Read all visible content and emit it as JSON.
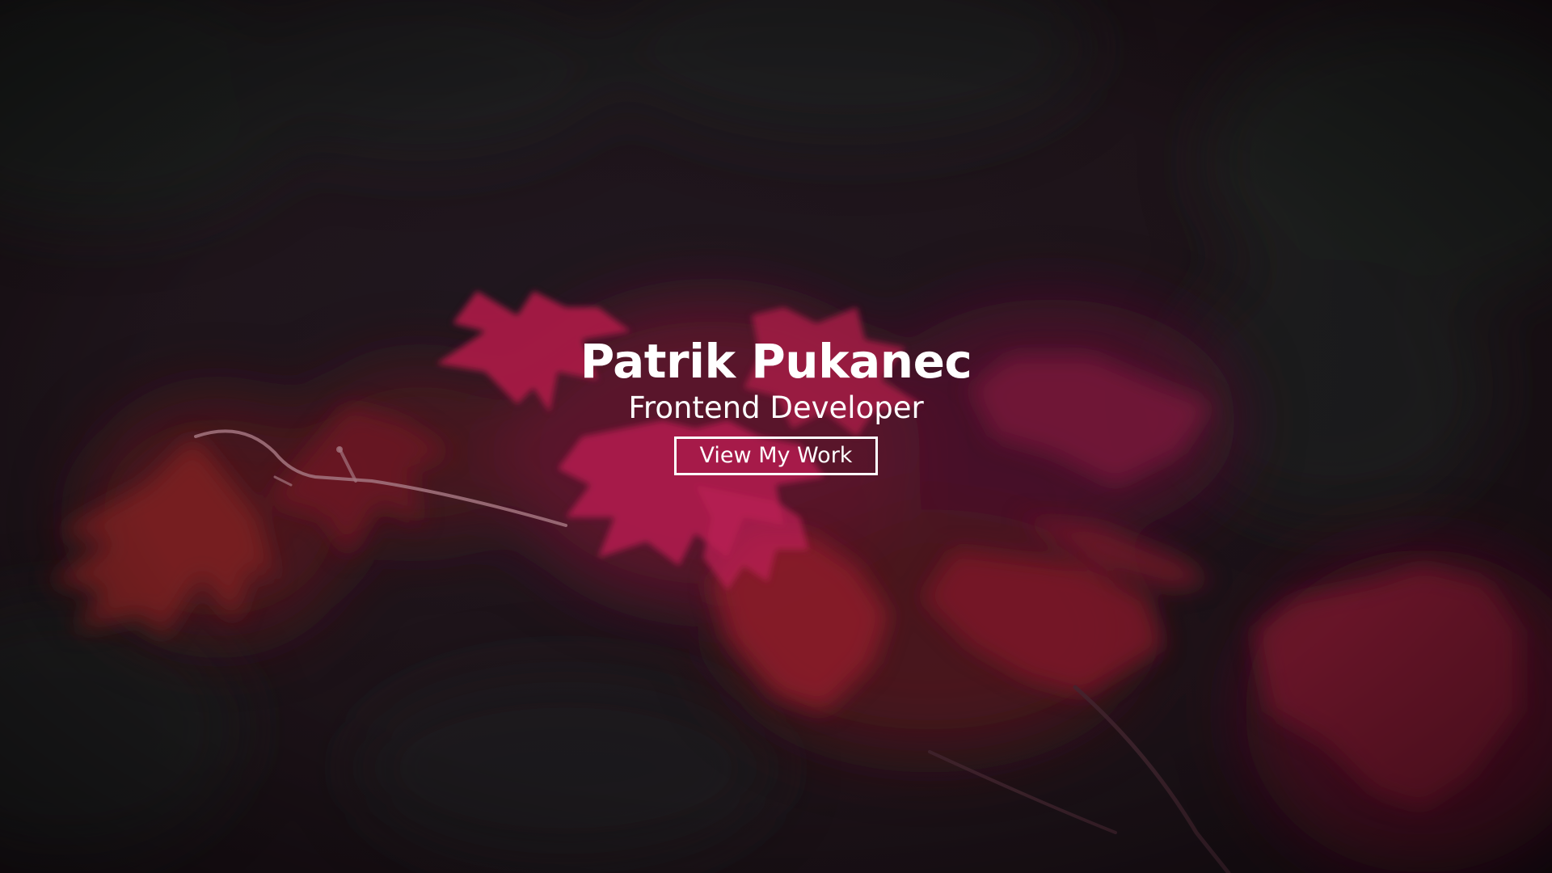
{
  "hero": {
    "title": "Patrik Pukanec",
    "subtitle": "Frontend Developer",
    "cta_label": "View My Work"
  },
  "colors": {
    "background": "#1c1219",
    "leaf_pink": "#c41e55",
    "leaf_red": "#9e1f2a",
    "text": "#ffffff"
  }
}
